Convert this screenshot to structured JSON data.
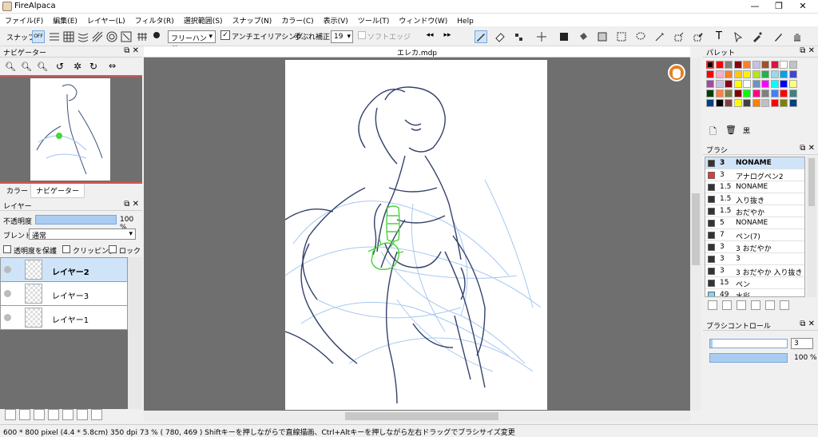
{
  "window": {
    "title": "FireAlpaca",
    "min": "—",
    "max": "❐",
    "close": "✕"
  },
  "menu": [
    "ファイル(F)",
    "編集(E)",
    "レイヤー(L)",
    "フィルタ(R)",
    "選択範囲(S)",
    "スナップ(N)",
    "カラー(C)",
    "表示(V)",
    "ツール(T)",
    "ウィンドウ(W)",
    "Help"
  ],
  "toolbar": {
    "snap_label": "スナップ",
    "snap_off": "OFF",
    "brush_mode": "フリーハンド",
    "antialias": "アンチエイリアシング",
    "stabilizer_label": "手ぶれ補正",
    "stabilizer_value": "19",
    "soft_edge": "ソフトエッジ"
  },
  "navigator": {
    "title": "ナビゲーター",
    "tabs": [
      "カラー",
      "ナビゲーター"
    ]
  },
  "layer_panel": {
    "title": "レイヤー",
    "opacity_label": "不透明度",
    "opacity_value": "100 %",
    "opacity": 1.0,
    "blend_label": "ブレンド",
    "blend_value": "通常",
    "protect_alpha": "透明度を保護",
    "clipping": "クリッピング",
    "lock": "ロック",
    "layers": [
      {
        "name": "レイヤー2",
        "selected": true
      },
      {
        "name": "レイヤー3",
        "selected": false
      },
      {
        "name": "レイヤー1",
        "selected": false
      }
    ]
  },
  "document": {
    "tab": "エレカ.mdp"
  },
  "palette": {
    "title": "パレット",
    "current_color_name": "黒",
    "colors": [
      "#000000",
      "#ff0000",
      "#7f7f7f",
      "#880015",
      "#ff7f27",
      "#c8bfe7",
      "#a0522d",
      "#dc143c",
      "#ffffff",
      "#c3c3c3",
      "#ff0000",
      "#ffaec9",
      "#ff7f27",
      "#ffc90e",
      "#fff200",
      "#b5e61d",
      "#22b14c",
      "#99d9ea",
      "#00a2e8",
      "#3f48cc",
      "#a349a4",
      "#c8bfe7",
      "#880015",
      "#ffff00",
      "#ffffff",
      "#7092be",
      "#ff00ff",
      "#00ffff",
      "#0000ff",
      "#ffff80",
      "#004000",
      "#ff8040",
      "#808040",
      "#800000",
      "#00ff00",
      "#ff0080",
      "#808080",
      "#4080ff",
      "#ff0000",
      "#408080",
      "#004080",
      "#000000",
      "#804040",
      "#ffff00",
      "#404040",
      "#ff8000",
      "#c0c0c0",
      "#ff0000",
      "#808000",
      "#004080"
    ]
  },
  "brush_panel": {
    "title": "ブラシ",
    "brushes": [
      {
        "size": "3",
        "name": "NONAME",
        "color": "#333333",
        "selected": true
      },
      {
        "size": "3",
        "name": "アナログペン2",
        "color": "#e53935",
        "selected": false
      },
      {
        "size": "1.5",
        "name": "NONAME",
        "color": "#333333",
        "selected": false
      },
      {
        "size": "1.5",
        "name": "入り抜き",
        "color": "#333333",
        "selected": false
      },
      {
        "size": "1.5",
        "name": "おだやか",
        "color": "#333333",
        "selected": false
      },
      {
        "size": "5",
        "name": "NONAME",
        "color": "#333333",
        "selected": false
      },
      {
        "size": "7",
        "name": "ペン(7)",
        "color": "#333333",
        "selected": false
      },
      {
        "size": "3",
        "name": "3 おだやか",
        "color": "#333333",
        "selected": false
      },
      {
        "size": "3",
        "name": "3",
        "color": "#333333",
        "selected": false
      },
      {
        "size": "3",
        "name": "3 おだやか 入り抜き",
        "color": "#333333",
        "selected": false
      },
      {
        "size": "15",
        "name": "ペン",
        "color": "#333333",
        "selected": false
      },
      {
        "size": "49",
        "name": "水彩",
        "color": "#7fd6ef",
        "selected": false
      }
    ]
  },
  "brush_control": {
    "title": "ブラシコントロール",
    "size_value": "3",
    "opacity_value": "100 %",
    "size": 0.03,
    "opacity": 1.0
  },
  "status": {
    "text": "600 * 800 pixel  (4.4 * 5.8cm)  350 dpi  73 %  ( 780, 469 )  Shiftキーを押しながらで直線描画、Ctrl+Altキーを押しながら左右ドラッグでブラシサイズ変更"
  }
}
